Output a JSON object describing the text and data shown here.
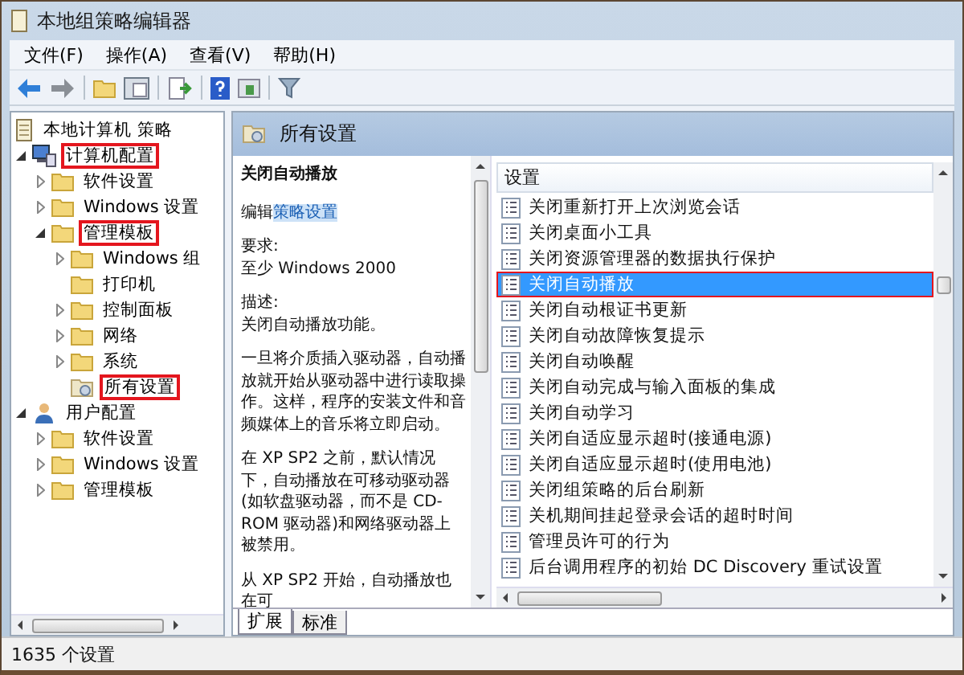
{
  "window": {
    "title": "本地组策略编辑器"
  },
  "menu": [
    "文件(F)",
    "操作(A)",
    "查看(V)",
    "帮助(H)"
  ],
  "tree": [
    {
      "label": "本地计算机 策略",
      "kind": "root",
      "highlighted": false,
      "children": [
        {
          "label": "计算机配置",
          "kind": "computer",
          "expanded": true,
          "highlighted": true,
          "children": [
            {
              "label": "软件设置",
              "kind": "folder",
              "expanded": false,
              "highlighted": false
            },
            {
              "label": "Windows 设置",
              "kind": "folder",
              "expanded": false,
              "highlighted": false
            },
            {
              "label": "管理模板",
              "kind": "folder",
              "expanded": true,
              "highlighted": true,
              "children": [
                {
                  "label": "Windows 组",
                  "kind": "folder",
                  "expanded": false,
                  "highlighted": false
                },
                {
                  "label": "打印机",
                  "kind": "folder",
                  "highlighted": false
                },
                {
                  "label": "控制面板",
                  "kind": "folder",
                  "expanded": false,
                  "highlighted": false
                },
                {
                  "label": "网络",
                  "kind": "folder",
                  "expanded": false,
                  "highlighted": false
                },
                {
                  "label": "系统",
                  "kind": "folder",
                  "expanded": false,
                  "highlighted": false
                },
                {
                  "label": "所有设置",
                  "kind": "settings",
                  "highlighted": true
                }
              ]
            }
          ]
        },
        {
          "label": "用户配置",
          "kind": "user",
          "expanded": true,
          "highlighted": false,
          "children": [
            {
              "label": "软件设置",
              "kind": "folder",
              "expanded": false,
              "highlighted": false
            },
            {
              "label": "Windows 设置",
              "kind": "folder",
              "expanded": false,
              "highlighted": false
            },
            {
              "label": "管理模板",
              "kind": "folder",
              "expanded": false,
              "highlighted": false
            }
          ]
        }
      ]
    }
  ],
  "header": {
    "title": "所有设置"
  },
  "description": {
    "title": "关闭自动播放",
    "edit_prefix": "编辑",
    "edit_link": "策略设置",
    "paragraphs": [
      "要求:\n至少 Windows 2000",
      "描述:\n关闭自动播放功能。",
      "一旦将介质插入驱动器，自动播放就开始从驱动器中进行读取操作。这样，程序的安装文件和音频媒体上的音乐将立即启动。",
      "在 XP SP2 之前，默认情况下，自动播放在可移动驱动器(如软盘驱动器，而不是 CD-ROM 驱动器)和网络驱动器上被禁用。",
      "从 XP SP2 开始，自动播放也在可"
    ]
  },
  "settings": {
    "column": "设置",
    "rows": [
      {
        "name": "关闭重新打开上次浏览会话",
        "selected": false,
        "highlighted": false
      },
      {
        "name": "关闭桌面小工具",
        "selected": false,
        "highlighted": false
      },
      {
        "name": "关闭资源管理器的数据执行保护",
        "selected": false,
        "highlighted": false
      },
      {
        "name": "关闭自动播放",
        "selected": true,
        "highlighted": true
      },
      {
        "name": "关闭自动根证书更新",
        "selected": false,
        "highlighted": false
      },
      {
        "name": "关闭自动故障恢复提示",
        "selected": false,
        "highlighted": false
      },
      {
        "name": "关闭自动唤醒",
        "selected": false,
        "highlighted": false
      },
      {
        "name": "关闭自动完成与输入面板的集成",
        "selected": false,
        "highlighted": false
      },
      {
        "name": "关闭自动学习",
        "selected": false,
        "highlighted": false
      },
      {
        "name": "关闭自适应显示超时(接通电源)",
        "selected": false,
        "highlighted": false
      },
      {
        "name": "关闭自适应显示超时(使用电池)",
        "selected": false,
        "highlighted": false
      },
      {
        "name": "关闭组策略的后台刷新",
        "selected": false,
        "highlighted": false
      },
      {
        "name": "关机期间挂起登录会话的超时时间",
        "selected": false,
        "highlighted": false
      },
      {
        "name": "管理员许可的行为",
        "selected": false,
        "highlighted": false
      },
      {
        "name": "后台调用程序的初始 DC Discovery 重试设置",
        "selected": false,
        "highlighted": false
      }
    ]
  },
  "tabs": [
    {
      "label": "扩展",
      "selected": true
    },
    {
      "label": "标准",
      "selected": false
    }
  ],
  "status_bar": {
    "text": "1635 个设置"
  }
}
